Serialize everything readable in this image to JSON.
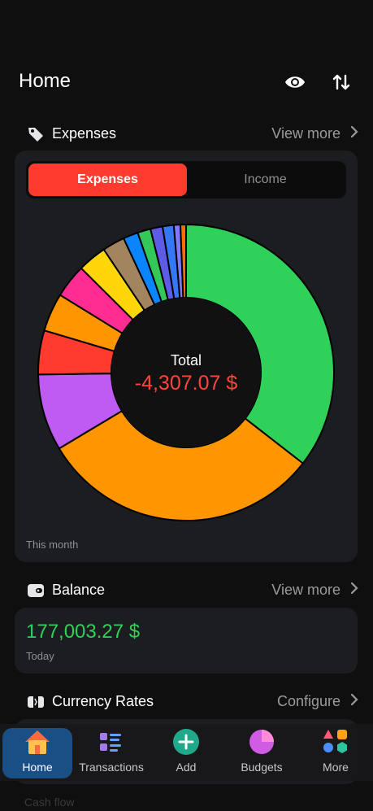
{
  "header": {
    "title": "Home",
    "icons": [
      "eye-icon",
      "sort-arrows-icon"
    ]
  },
  "expenses_section": {
    "title": "Expenses",
    "action": "View more",
    "icon": "tag-icon",
    "segmented": {
      "active": "Expenses",
      "inactive": "Income"
    },
    "total_label": "Total",
    "total_value": "-4,307.07 $",
    "period": "This month"
  },
  "chart_data": {
    "type": "pie",
    "title": "",
    "slices": [
      {
        "color": "#30d158",
        "value": 0.348
      },
      {
        "color": "#ff9500",
        "value": 0.303
      },
      {
        "color": "#bf5af2",
        "value": 0.082
      },
      {
        "color": "#ff3b30",
        "value": 0.047
      },
      {
        "color": "#ff9500",
        "value": 0.041
      },
      {
        "color": "#ff2d92",
        "value": 0.036
      },
      {
        "color": "#ffd60a",
        "value": 0.031
      },
      {
        "color": "#a2845e",
        "value": 0.024
      },
      {
        "color": "#0a84ff",
        "value": 0.016
      },
      {
        "color": "#34c759",
        "value": 0.014
      },
      {
        "color": "#5e5ce6",
        "value": 0.013
      },
      {
        "color": "#3478f6",
        "value": 0.012
      },
      {
        "color": "#7d7aff",
        "value": 0.007
      },
      {
        "color": "#ff6b00",
        "value": 0.006
      }
    ]
  },
  "balance_section": {
    "title": "Balance",
    "action": "View more",
    "icon": "wallet-icon",
    "value": "177,003.27 $",
    "date": "Today"
  },
  "currency_section": {
    "title": "Currency Rates",
    "action": "Configure",
    "icon": "exchange-icon"
  },
  "tabbar": [
    {
      "label": "Home",
      "icon": "home-icon",
      "active": true
    },
    {
      "label": "Transactions",
      "icon": "list-icon",
      "active": false
    },
    {
      "label": "Add",
      "icon": "plus-circle-icon",
      "active": false
    },
    {
      "label": "Budgets",
      "icon": "pie-icon",
      "active": false
    },
    {
      "label": "More",
      "icon": "shapes-icon",
      "active": false
    }
  ],
  "footer_ghost": "Cash flow"
}
